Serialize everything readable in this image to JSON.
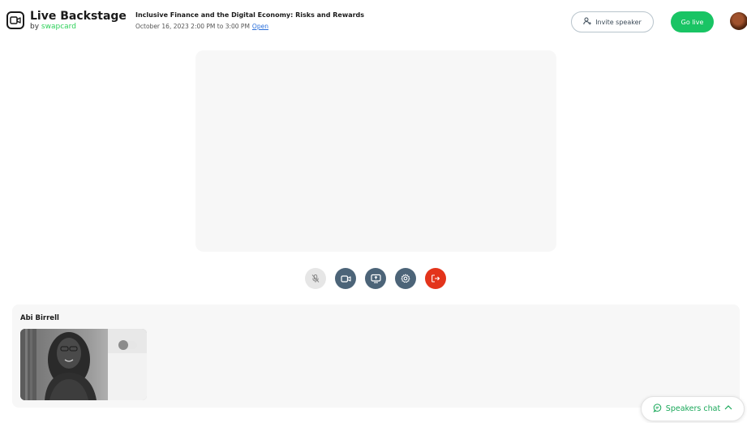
{
  "brand": {
    "title": "Live Backstage",
    "by": "by",
    "company": "swapcard"
  },
  "event": {
    "title": "Inclusive Finance and the Digital Economy: Risks and Rewards",
    "time": "October 16, 2023 2:00 PM to 3:00 PM",
    "status_link": "Open"
  },
  "header_actions": {
    "invite_label": "Invite speaker",
    "golive_label": "Go live"
  },
  "controls": [
    {
      "name": "microphone-muted",
      "icon": "mic-off-icon"
    },
    {
      "name": "camera",
      "icon": "camera-icon"
    },
    {
      "name": "share-screen",
      "icon": "screen-share-icon"
    },
    {
      "name": "settings",
      "icon": "gear-icon"
    },
    {
      "name": "leave",
      "icon": "exit-icon"
    }
  ],
  "speakers": [
    {
      "name": "Abi Birrell"
    }
  ],
  "chat": {
    "label": "Speakers chat"
  },
  "colors": {
    "accent_green": "#19c464",
    "control_dark": "#4c6478",
    "leave_red": "#e3341b",
    "link_blue": "#2a6fdb"
  }
}
